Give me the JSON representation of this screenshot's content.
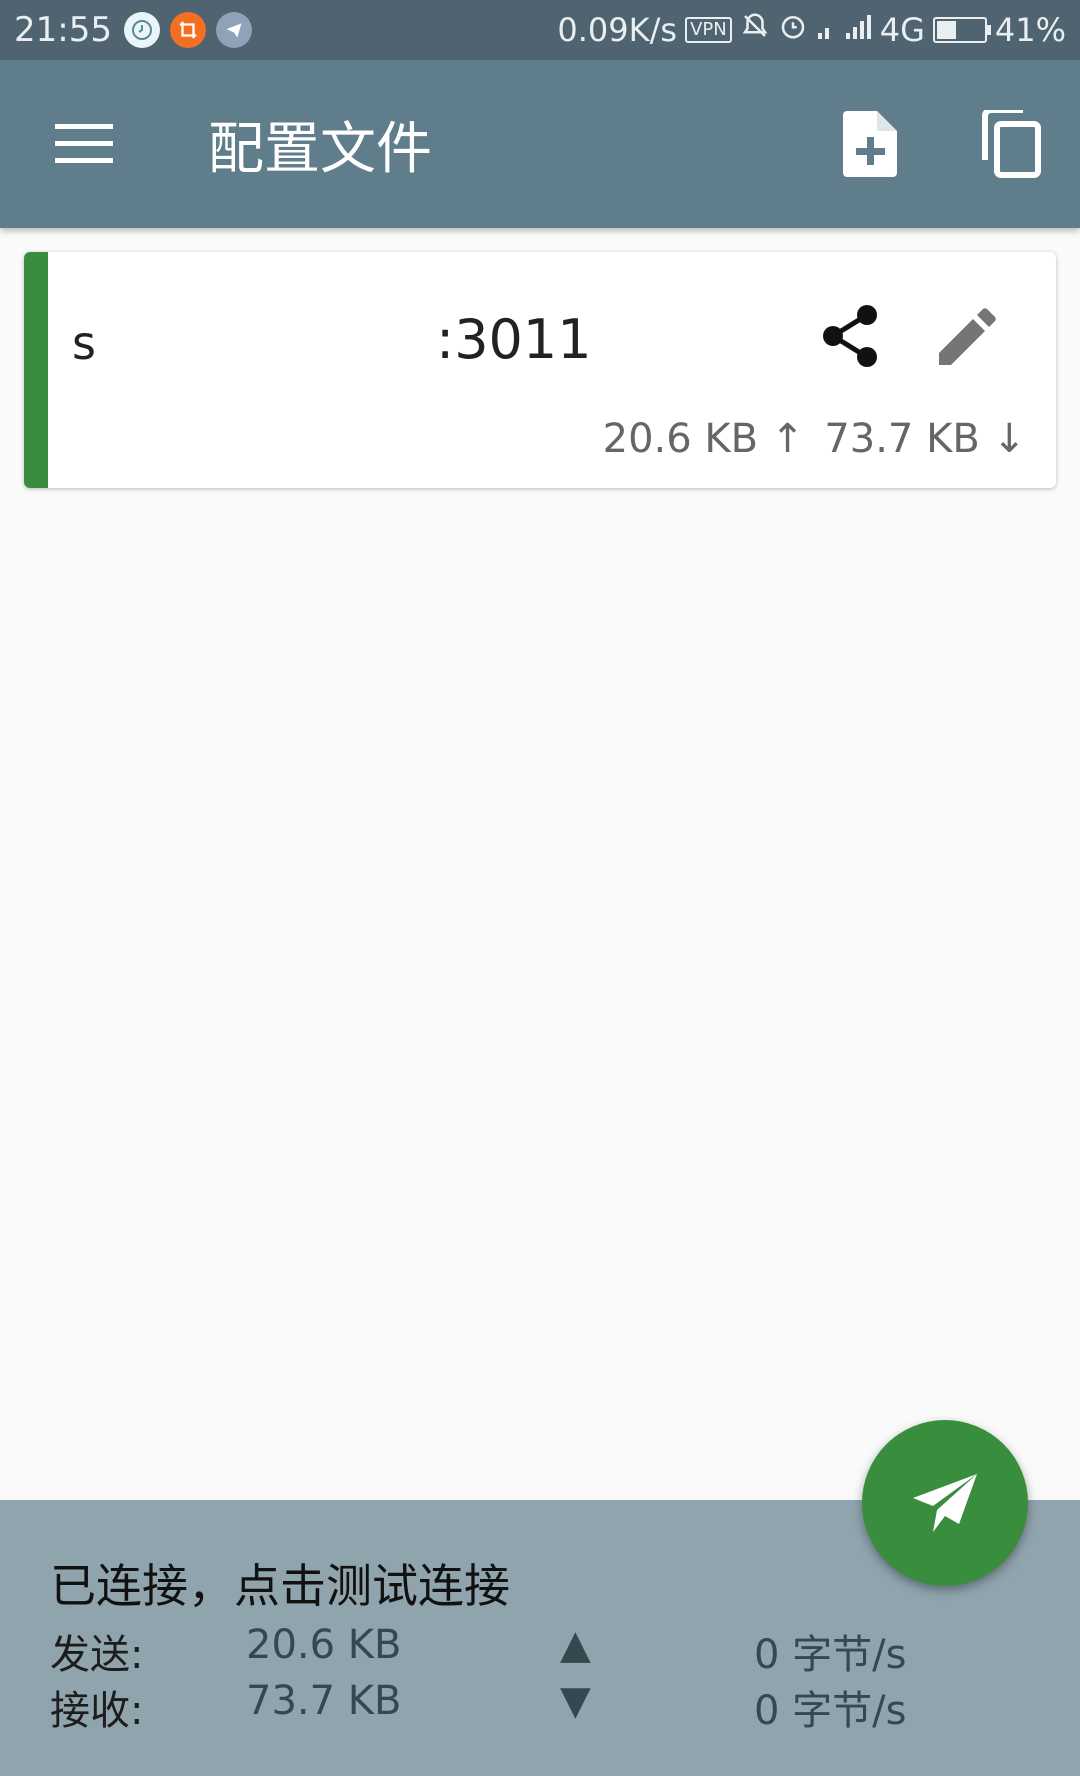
{
  "status_bar": {
    "time": "21:55",
    "net_speed": "0.09K/s",
    "vpn_label": "VPN",
    "network": "4G",
    "battery_percent": "41%",
    "battery_level": 0.41,
    "icons": [
      "clock-app-icon",
      "crop-app-icon",
      "telegram-icon",
      "vpn-icon",
      "mute-bell-icon",
      "alarm-icon",
      "signal-icon",
      "battery-icon"
    ]
  },
  "toolbar": {
    "title": "配置文件",
    "icons": {
      "menu": "menu-icon",
      "add": "add-file-icon",
      "copy": "copy-icon"
    }
  },
  "profile": {
    "name": "s",
    "address": ":3011",
    "upload": "20.6 KB ↑",
    "download": "73.7 KB ↓",
    "accent_color": "#388e3c",
    "icons": {
      "share": "share-icon",
      "edit": "edit-icon"
    }
  },
  "stats": {
    "status": "已连接，点击测试连接",
    "send_label": "发送:",
    "send_value": "20.6 KB",
    "send_arrow": "▲",
    "send_rate": "0 字节/s",
    "recv_label": "接收:",
    "recv_value": "73.7 KB",
    "recv_arrow": "▼",
    "recv_rate": "0 字节/s"
  },
  "fab": {
    "icon": "send-icon",
    "color": "#388e3c"
  },
  "colors": {
    "toolbar": "#607d8b",
    "statusbar": "#4f6470",
    "panel": "#90a4ae"
  }
}
